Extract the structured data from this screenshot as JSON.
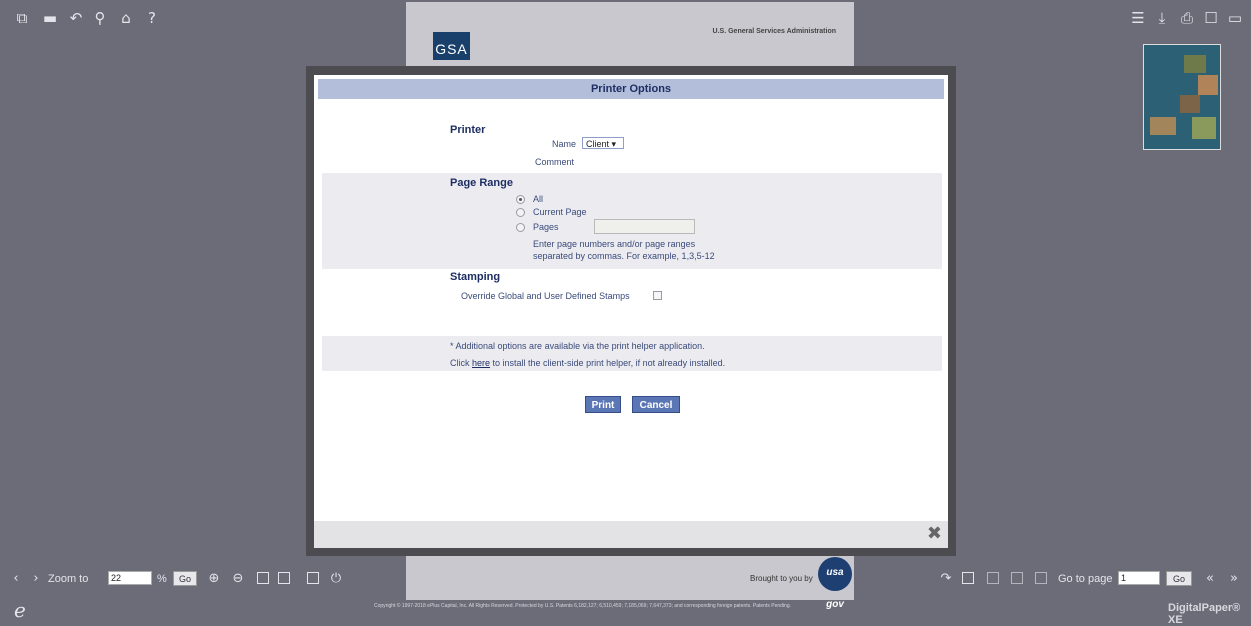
{
  "top_left_toolbar": [
    "new-document-icon",
    "folder-icon",
    "undo-icon",
    "search-icon",
    "home-icon",
    "help-icon"
  ],
  "top_right_toolbar": [
    "list-icon",
    "download-icon",
    "print-icon",
    "fullscreen-icon",
    "panel-icon"
  ],
  "document": {
    "logo_text": "GSA",
    "header_text": "U.S. General Services Administration",
    "brought_by": "Brought to you by",
    "usagov_logo": "usa gov"
  },
  "dialog": {
    "title": "Printer Options",
    "printer": {
      "heading": "Printer",
      "name_label": "Name",
      "name_value": "Client ▾",
      "comment_label": "Comment"
    },
    "page_range": {
      "heading": "Page Range",
      "options": [
        {
          "label": "All",
          "selected": true
        },
        {
          "label": "Current Page",
          "selected": false
        },
        {
          "label": "Pages",
          "selected": false
        }
      ],
      "pages_value": "",
      "hint_line1": "Enter page numbers and/or page ranges",
      "hint_line2": "separated by commas. For example, 1,3,5-12"
    },
    "stamping": {
      "heading": "Stamping",
      "override_label": "Override Global and User Defined Stamps",
      "override_checked": false
    },
    "info": {
      "line1": "* Additional options are available via the print helper application.",
      "line2_prefix": "Click ",
      "line2_link": "here",
      "line2_suffix": " to install the client-side print helper, if not already installed."
    },
    "print_button": "Print",
    "cancel_button": "Cancel",
    "close_icon": "✖"
  },
  "bottom_toolbar": {
    "zoom_label": "Zoom to",
    "zoom_value": "22",
    "zoom_unit": "%",
    "go_label": "Go",
    "goto_label": "Go to page",
    "goto_value": "1",
    "goto_go": "Go"
  },
  "status_bar": {
    "copyright": "Copyright © 1997-2018 ePlus Capital, Inc. All Rights Reserved. Protected by U.S. Patents 6,182,127; 6,510,459; 7,185,069; 7,647,373; and corresponding foreign patents. Patents Pending.",
    "e_logo": "e",
    "brand": "DigitalPaper® XE"
  }
}
